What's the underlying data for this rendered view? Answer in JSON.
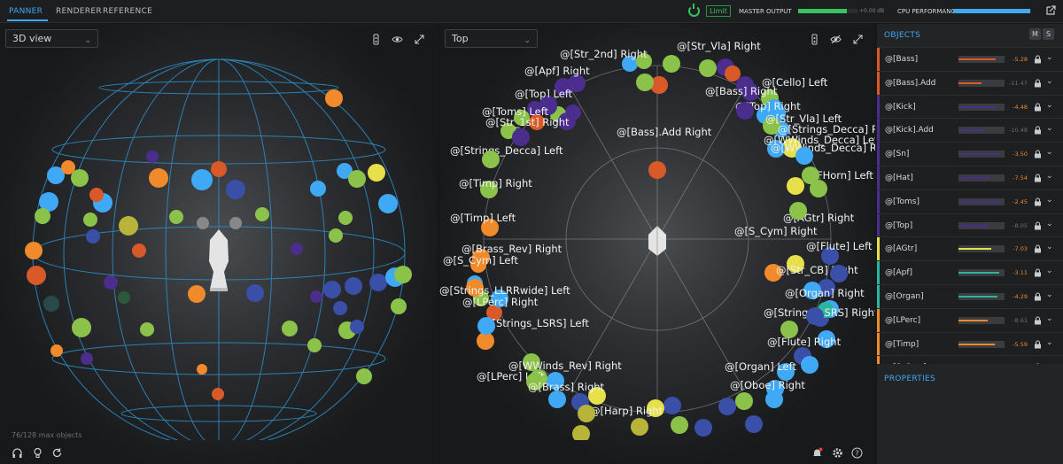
{
  "topbar": {
    "tabs": [
      {
        "label": "PANNER",
        "active": true
      },
      {
        "label": "RENDERER",
        "active": false
      },
      {
        "label": "REFERENCE",
        "active": false
      }
    ],
    "limit_label": "Limit",
    "master_output_label": "MASTER OUTPUT",
    "master_output_value": "+0.00 dB",
    "master_output_level": 0.82,
    "cpu_label": "CPU PERFORMANCE",
    "cpu_level": 0.99,
    "accent_color": "#3fa9f5"
  },
  "view_left": {
    "select_value": "3D view",
    "object_count": "76/128 max objects"
  },
  "view_right": {
    "select_value": "Top",
    "spheres": [
      {
        "label": "@[Bass].Add Right",
        "color": "#d95a28"
      },
      {
        "label": "@[Strings_Decca] Left",
        "color": "#8bc34a"
      },
      {
        "label": "@[Timp] Right",
        "color": "#f08a2a"
      },
      {
        "label": "@[Timp] Left",
        "color": "#f08a2a"
      },
      {
        "label": "@[Brass_Rev] Right",
        "color": "#f08a2a"
      },
      {
        "label": "@[S_Cym] Left",
        "color": "#3fa9f5"
      },
      {
        "label": "@[LPerc] Right",
        "color": "#f08a2a"
      },
      {
        "label": "@[Strings_LSRS] Left",
        "color": "#8bc34a"
      },
      {
        "label": "@[AGtr] Right",
        "color": "#e8e04a"
      },
      {
        "label": "@[S_Cym] Right",
        "color": "#f08a2a"
      },
      {
        "label": "@[FHorn] Left",
        "color": "#8bc34a"
      },
      {
        "label": "@[Str_CB] Right",
        "color": "#3fa9f5"
      },
      {
        "label": "@[Strings_LLRRwide] Left",
        "color": "#3fa9f5"
      },
      {
        "label": "@[Strings_LSRS] Right",
        "color": "#8bc34a"
      },
      {
        "label": "@[Flute] Right",
        "color": "#3fa9f5"
      },
      {
        "label": "@[Organ] Left",
        "color": "#3fa9f5"
      },
      {
        "label": "@[Oboe] Right",
        "color": "#3a4fa8"
      },
      {
        "label": "@[LPerc] Left",
        "color": "#3fa9f5"
      },
      {
        "label": "@[Harp] Right",
        "color": "#b8b43a"
      },
      {
        "label": "@[WWinds_Rev] Right",
        "color": "#8bc34a"
      },
      {
        "label": "@[Brass] Right",
        "color": "#b8b43a"
      },
      {
        "label": "@[Str_Vla] Right",
        "color": "#3fa9f5"
      },
      {
        "label": "@[Top] Right",
        "color": "#3fa9f5"
      },
      {
        "label": "@[Cello] Left",
        "color": "#8bc34a"
      },
      {
        "label": "@[Top] Left",
        "color": "#4a2d8c"
      },
      {
        "label": "@[Str_2nd] Right",
        "color": "#8bc34a"
      },
      {
        "label": "@[Str_1st] Right",
        "color": "#8bc34a"
      },
      {
        "label": "@[WWinds_Decca] Left",
        "color": "#e8e04a"
      },
      {
        "label": "@[WWinds_Decca] Right",
        "color": "#8bc34a"
      },
      {
        "label": "@[Str_Vla] Left",
        "color": "#3fa9f5"
      },
      {
        "label": "@[Strings_Decca] Right",
        "color": "#8bc34a"
      },
      {
        "label": "@[Apf] Right",
        "color": "#4a2d8c"
      },
      {
        "label": "@[Toms] Left",
        "color": "#4a2d8c"
      },
      {
        "label": "@[Bass] Right",
        "color": "#4a2d8c"
      },
      {
        "label": "@[Flute] Left",
        "color": "#3a4fa8"
      },
      {
        "label": "@[Organ] Right",
        "color": "#3a4fa8"
      }
    ]
  },
  "panel": {
    "objects_title": "OBJECTS",
    "m_label": "M",
    "s_label": "S",
    "properties_title": "PROPERTIES",
    "objects": [
      {
        "name": "@[Bass]",
        "value": "-5.28",
        "color": "#d95a28",
        "level": 0.8,
        "active": true
      },
      {
        "name": "@[Bass].Add",
        "value": "-11.47",
        "color": "#d95a28",
        "level": 0.5,
        "active": false
      },
      {
        "name": "@[Kick]",
        "value": "-4.48",
        "color": "#4a2d8c",
        "level": 0.83,
        "active": true
      },
      {
        "name": "@[Kick].Add",
        "value": "-10.48",
        "color": "#4a2d8c",
        "level": 0.55,
        "active": false
      },
      {
        "name": "@[Sn]",
        "value": "-3.50",
        "color": "#4a2d8c",
        "level": 0.87,
        "active": true
      },
      {
        "name": "@[Hat]",
        "value": "-7.54",
        "color": "#4a2d8c",
        "level": 0.7,
        "active": true
      },
      {
        "name": "@[Toms]",
        "value": "-2.45",
        "color": "#4a2d8c",
        "level": 0.92,
        "active": true
      },
      {
        "name": "@[Top]",
        "value": "-8.05",
        "color": "#4a2d8c",
        "level": 0.66,
        "active": false
      },
      {
        "name": "@[AGtr]",
        "value": "-7.03",
        "color": "#e8e04a",
        "level": 0.72,
        "active": true
      },
      {
        "name": "@[Apf]",
        "value": "-3.11",
        "color": "#2bb5a0",
        "level": 0.88,
        "active": true
      },
      {
        "name": "@[Organ]",
        "value": "-4.29",
        "color": "#2bb5a0",
        "level": 0.84,
        "active": true
      },
      {
        "name": "@[LPerc]",
        "value": "-8.61",
        "color": "#f08a2a",
        "level": 0.64,
        "active": false
      },
      {
        "name": "@[Timp]",
        "value": "-5.59",
        "color": "#f08a2a",
        "level": 0.78,
        "active": true
      },
      {
        "name": "@[S_Cym]",
        "value": "",
        "color": "#f08a2a",
        "level": 0.6,
        "active": false
      }
    ]
  }
}
